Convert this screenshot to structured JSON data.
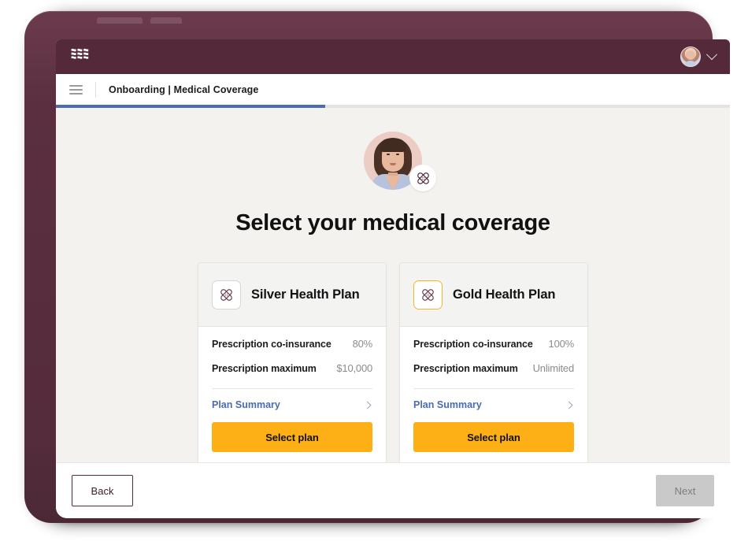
{
  "brand": {
    "logo_icon": "rippling-waves-logo",
    "bar_color": "#54293a",
    "avatar_icon": "user-avatar",
    "chevron_icon": "chevron-down-icon"
  },
  "breadcrumb": {
    "menu_icon": "hamburger-menu-icon",
    "text": "Onboarding | Medical Coverage"
  },
  "progress": {
    "percent": 40,
    "fill_color": "#4a6cb0",
    "track_color": "#e4e3e1"
  },
  "hero": {
    "avatar_icon": "person-avatar",
    "badge_icon": "bandage-medical-icon"
  },
  "main": {
    "title": "Select your medical coverage"
  },
  "plans": [
    {
      "name": "Silver Health Plan",
      "icon": "bandage-medical-icon",
      "icon_border_color": "#d8d6d3",
      "rows": [
        {
          "label": "Prescription co-insurance",
          "value": "80%"
        },
        {
          "label": "Prescription maximum",
          "value": "$10,000"
        }
      ],
      "summary_label": "Plan Summary",
      "summary_chevron_icon": "chevron-right-icon",
      "button_label": "Select plan",
      "button_color": "#fcb016"
    },
    {
      "name": "Gold Health Plan",
      "icon": "bandage-medical-icon",
      "icon_border_color": "#f7b32b",
      "rows": [
        {
          "label": "Prescription co-insurance",
          "value": "100%"
        },
        {
          "label": "Prescription maximum",
          "value": "Unlimited"
        }
      ],
      "summary_label": "Plan Summary",
      "summary_chevron_icon": "chevron-right-icon",
      "button_label": "Select plan",
      "button_color": "#fcb016"
    }
  ],
  "footer": {
    "back_label": "Back",
    "next_label": "Next"
  }
}
